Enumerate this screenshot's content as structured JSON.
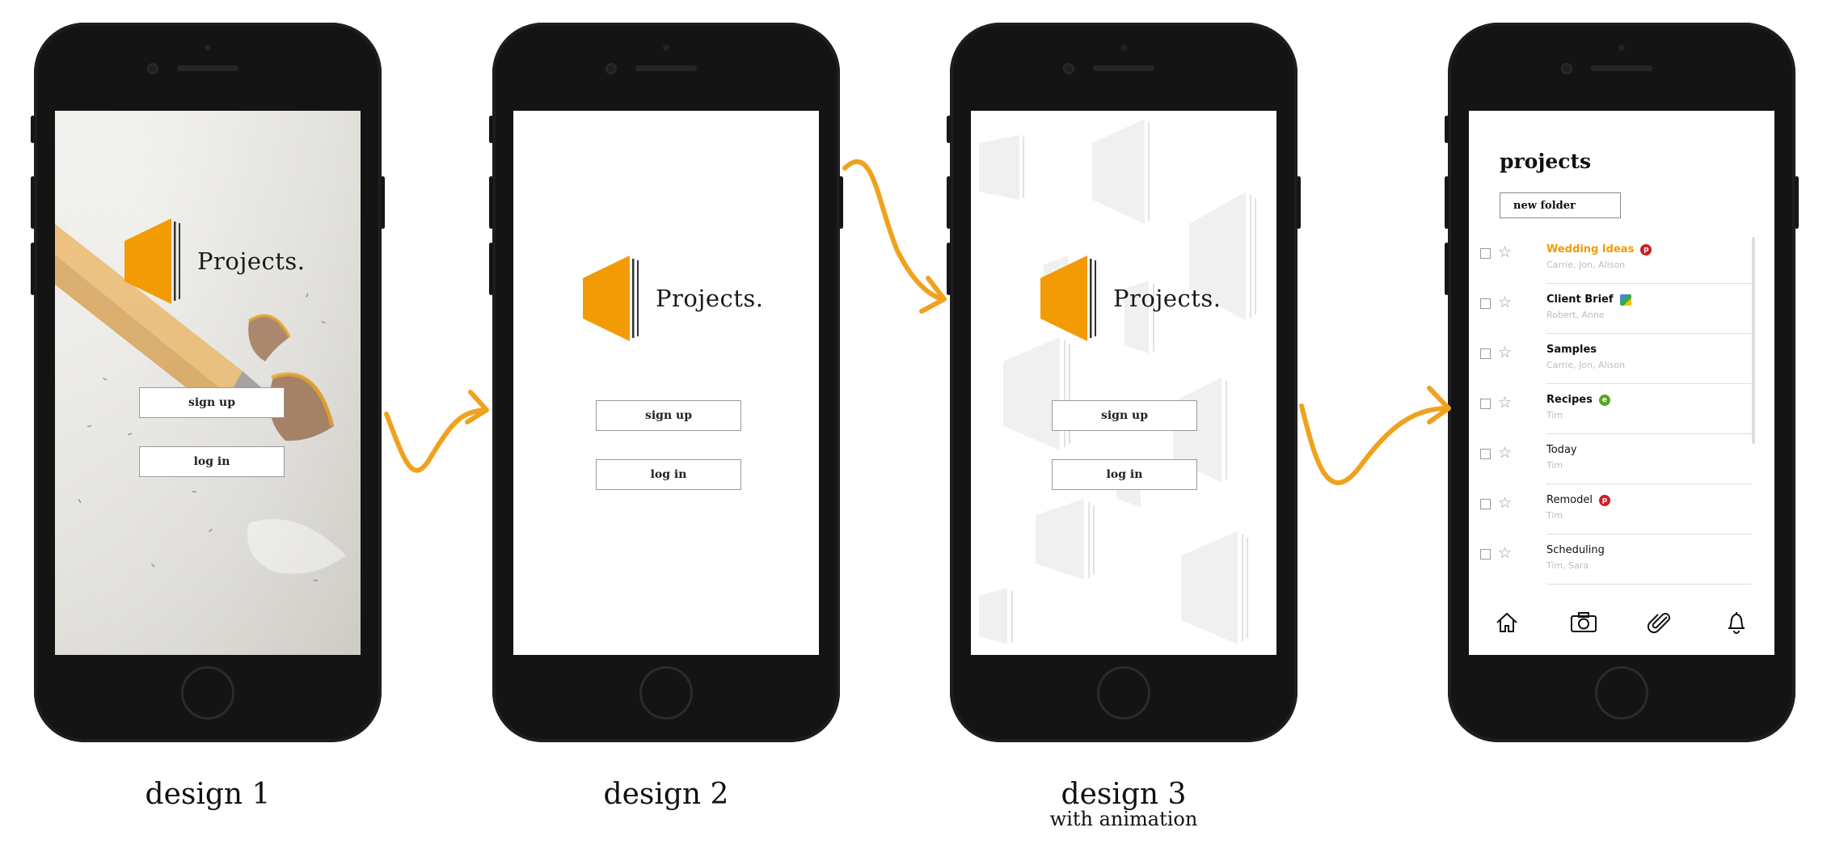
{
  "designs": [
    {
      "caption": "design 1",
      "app_name": "Projects.",
      "signup_label": "sign up",
      "login_label": "log in"
    },
    {
      "caption": "design 2",
      "app_name": "Projects.",
      "signup_label": "sign up",
      "login_label": "log in"
    },
    {
      "caption": "design 3",
      "subcaption": "with animation",
      "app_name": "Projects.",
      "signup_label": "sign up",
      "login_label": "log in"
    }
  ],
  "projects_screen": {
    "title": "projects",
    "new_folder_label": "new folder",
    "items": [
      {
        "name": "Wedding Ideas",
        "members": "Carrie, Jon, Alison",
        "style": "accent",
        "badge": "pinterest-icon"
      },
      {
        "name": "Client Brief",
        "members": "Robert, Anne",
        "style": "bold",
        "badge": "drive-icon"
      },
      {
        "name": "Samples",
        "members": "Carrie, Jon, Alison",
        "style": "bold",
        "badge": ""
      },
      {
        "name": "Recipes",
        "members": "Tim",
        "style": "bold",
        "badge": "evernote-icon"
      },
      {
        "name": "Today",
        "members": "Tim",
        "style": "regular",
        "badge": ""
      },
      {
        "name": "Remodel",
        "members": "Tim",
        "style": "regular",
        "badge": "pinterest-icon"
      },
      {
        "name": "Scheduling",
        "members": "Tim, Sara",
        "style": "regular",
        "badge": ""
      }
    ],
    "tabs": [
      "home-icon",
      "camera-icon",
      "paperclip-icon",
      "bell-icon"
    ]
  },
  "colors": {
    "accent": "#f29b05",
    "pinterest": "#cb1f27",
    "evernote": "#5ba525"
  }
}
